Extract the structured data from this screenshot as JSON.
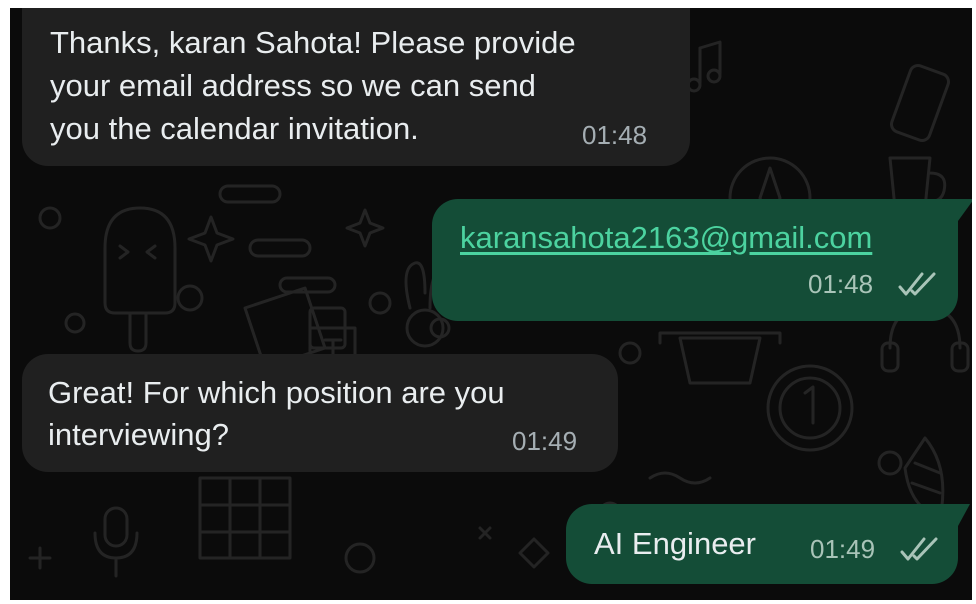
{
  "messages": [
    {
      "direction": "incoming",
      "lines": [
        "Thanks, karan Sahota! Please provide",
        "your email address so we can send",
        "you the calendar invitation."
      ],
      "time": "01:48"
    },
    {
      "direction": "outgoing",
      "link": "karansahota2163@gmail.com",
      "time": "01:48",
      "status_icon": "double-check-read-icon"
    },
    {
      "direction": "incoming",
      "lines": [
        "Great! For which position are you",
        "interviewing?"
      ],
      "time": "01:49"
    },
    {
      "direction": "outgoing",
      "text": "AI Engineer",
      "time": "01:49",
      "status_icon": "double-check-read-icon"
    }
  ],
  "colors": {
    "chat_background": "#0b0b0b",
    "incoming_bubble": "#202020",
    "outgoing_bubble": "#144d37",
    "link": "#4cd3a0",
    "text": "#e9edef",
    "timestamp": "#a5aeb3"
  }
}
